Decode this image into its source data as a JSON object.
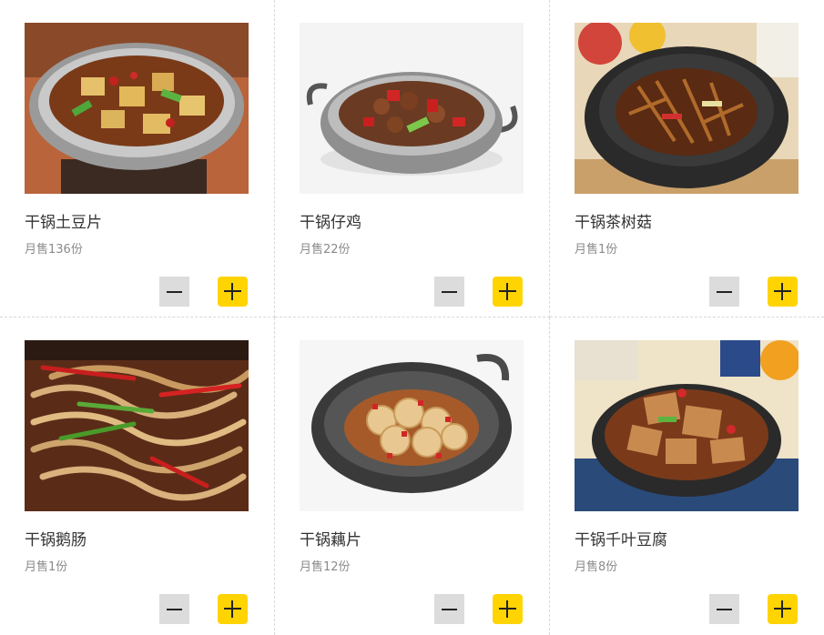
{
  "dishes": [
    {
      "name": "干锅土豆片",
      "sales": "月售136份",
      "minus_icon": "minus-icon",
      "plus_icon": "plus-icon"
    },
    {
      "name": "干锅仔鸡",
      "sales": "月售22份",
      "minus_icon": "minus-icon",
      "plus_icon": "plus-icon"
    },
    {
      "name": "干锅茶树菇",
      "sales": "月售1份",
      "minus_icon": "minus-icon",
      "plus_icon": "plus-icon"
    },
    {
      "name": "干锅鹅肠",
      "sales": "月售1份",
      "minus_icon": "minus-icon",
      "plus_icon": "plus-icon"
    },
    {
      "name": "干锅藕片",
      "sales": "月售12份",
      "minus_icon": "minus-icon",
      "plus_icon": "plus-icon"
    },
    {
      "name": "干锅千叶豆腐",
      "sales": "月售8份",
      "minus_icon": "minus-icon",
      "plus_icon": "plus-icon"
    }
  ],
  "colors": {
    "plus_button": "#ffd400",
    "minus_button": "#dcdcdc",
    "divider": "#d9d9d9",
    "name_text": "#333333",
    "sales_text": "#8a8a8a"
  }
}
